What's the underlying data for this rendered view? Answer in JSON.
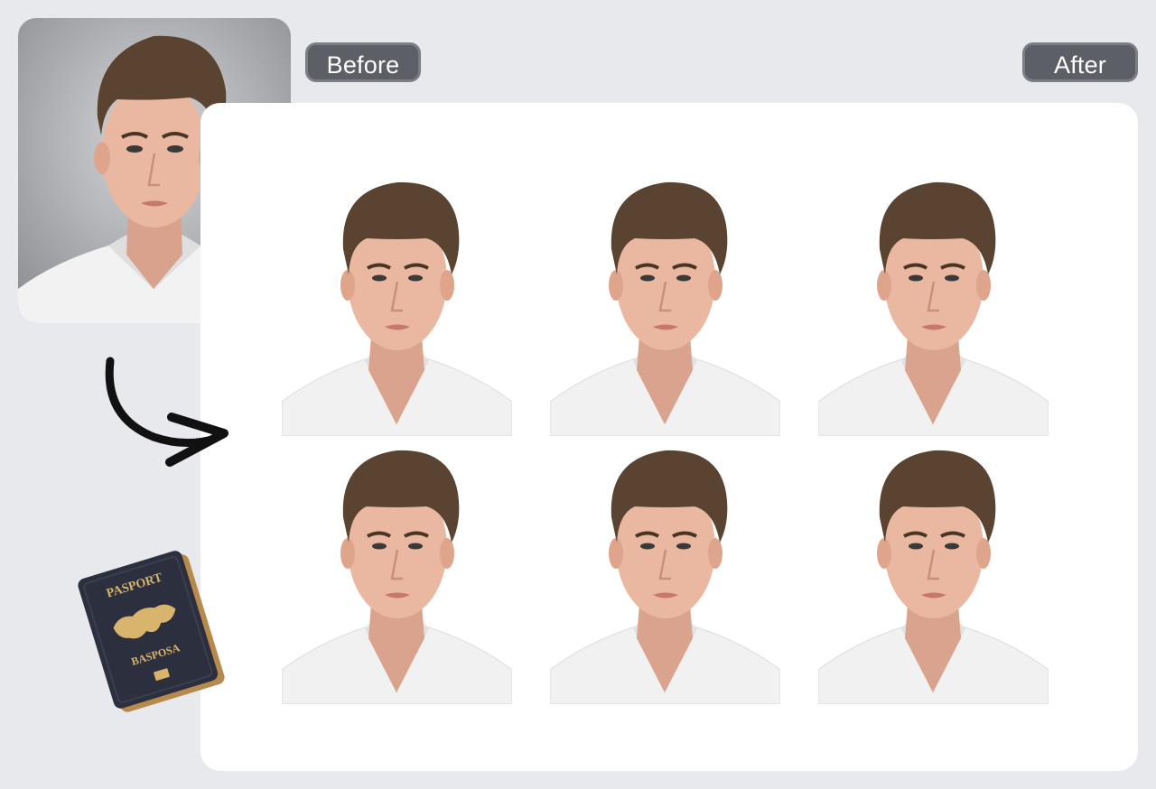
{
  "labels": {
    "before": "Before",
    "after": "After"
  },
  "before_photo": {
    "background": "#9a9ca0",
    "icon": "portrait-photo"
  },
  "after_grid": {
    "rows": 2,
    "columns": 3,
    "photo_count": 6,
    "background": "#ffffff",
    "icon": "passport-photo"
  },
  "passport": {
    "title": "PASPORT",
    "subtitle": "BASPOSA",
    "icon": "passport-icon"
  },
  "colors": {
    "pill_bg": "#5c5f66",
    "page_bg": "#e8e9ed",
    "hair": "#5a4330",
    "skin": "#e9b9a2",
    "shirt": "#f3f3f3"
  }
}
